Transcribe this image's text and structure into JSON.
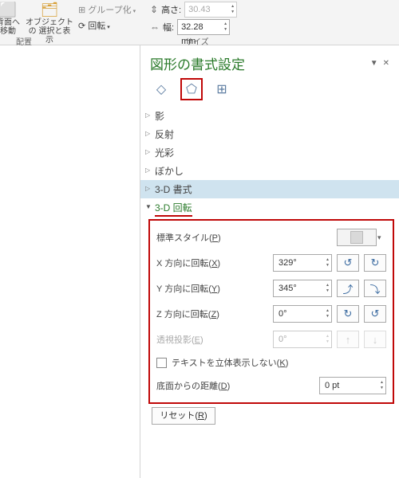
{
  "ribbon": {
    "move_back": "背面へ\n移動",
    "selection_pane": "オブジェクトの\n選択と表示",
    "group": "グループ化",
    "rotate": "回転",
    "arrange_cap": "配置",
    "height": "高さ:",
    "height_val": "30.43 mm",
    "width": "幅:",
    "width_val": "32.28 mm",
    "size_cap": "サイズ"
  },
  "pane": {
    "title": "図形の書式設定",
    "sections": {
      "shadow": "影",
      "reflection": "反射",
      "glow": "光彩",
      "blur": "ぼかし",
      "fmt3d": "3-D 書式",
      "rot3d": "3-D 回転"
    },
    "rot": {
      "preset": "標準スタイル(",
      "preset_k": "P",
      "xrot": "X 方向に回転(",
      "xrot_k": "X",
      "yrot": "Y 方向に回転(",
      "yrot_k": "Y",
      "zrot": "Z 方向に回転(",
      "zrot_k": "Z",
      "persp": "透視投影(",
      "persp_k": "E",
      "flat_pre": "テキストを立体表示しない(",
      "flat_k": "K",
      "dist": "底面からの距離(",
      "dist_k": "D",
      "xval": "329°",
      "yval": "345°",
      "zval": "0°",
      "pval": "0°",
      "dval": "0 pt",
      "reset": "リセット(",
      "reset_k": "R"
    }
  }
}
